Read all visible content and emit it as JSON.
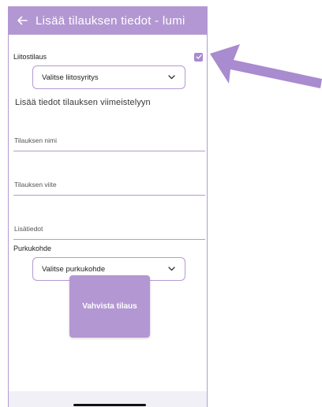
{
  "header": {
    "title": "Lisää tilauksen tiedot - lumi",
    "back_icon": "arrow-left-icon"
  },
  "form": {
    "connection_order_label": "Liitostilaus",
    "connection_order_checked": true,
    "connection_company_select": "Valitse liitosyritys",
    "finishing_heading": "Lisää tiedot tilauksen viimeistelyyn",
    "order_name_placeholder": "Tilauksen nimi",
    "order_reference_placeholder": "Tilauksen viite",
    "additional_info_placeholder": "Lisätiedot",
    "unloading_site_label": "Purkukohde",
    "unloading_site_select": "Valitse purkukohde",
    "submit_label": "Vahvista tilaus"
  },
  "colors": {
    "accent": "#b397d2",
    "arrow": "#a98bcf"
  }
}
